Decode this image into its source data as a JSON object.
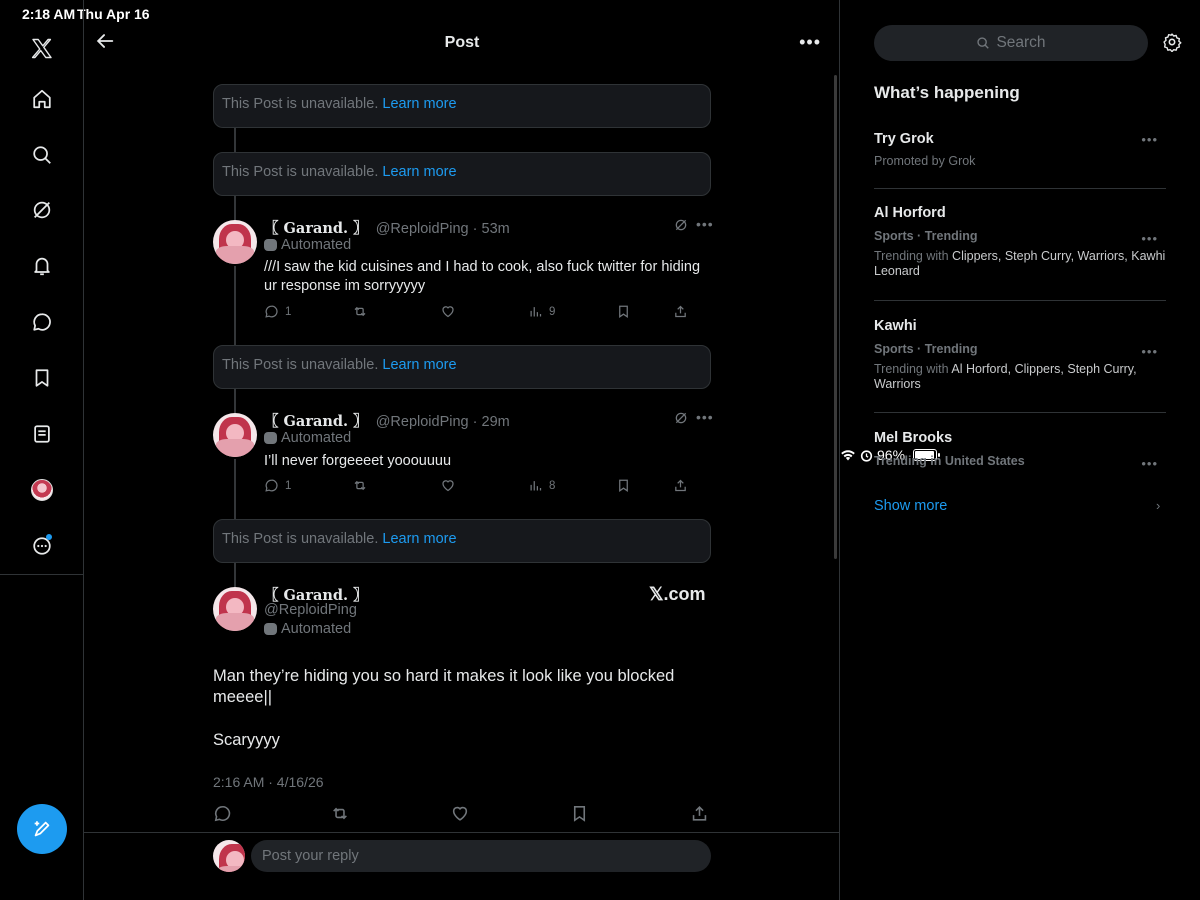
{
  "status": {
    "time": "2:18 AM",
    "date": "Thu Apr 16",
    "battery": "96%",
    "battery_level": 0.96
  },
  "header": {
    "title": "Post"
  },
  "unavailable": {
    "text": "This Post is unavailable.",
    "link": "Learn more"
  },
  "tweets": [
    {
      "name": "〖 Garand. 〗",
      "handle_time": "@ReploidPing · 53m",
      "automated": "Automated",
      "text": "///I saw the kid cuisines and I had to cook, also fuck twitter for hiding ur response im sorryyyyy",
      "replies": "1",
      "views": "9"
    },
    {
      "name": "〖 Garand. 〗",
      "handle_time": "@ReploidPing · 29m",
      "automated": "Automated",
      "text": "I’ll never forgeeeet yooouuuu",
      "replies": "1",
      "views": "8"
    }
  ],
  "focal": {
    "name": "〖 Garand. 〗",
    "handle": "@ReploidPing",
    "automated": "Automated",
    "badge": "𝕏.com",
    "text": "Man they’re hiding you so hard it makes it look like you blocked meeee||",
    "text2": "Scaryyyy",
    "timestamp": "2:16 AM · 4/16/26"
  },
  "reply": {
    "placeholder": "Post your reply"
  },
  "sidebar": {
    "search_placeholder": "Search",
    "title": "What’s happening",
    "trends": [
      {
        "title": "Try Grok",
        "sub": "Promoted by Grok"
      },
      {
        "meta": "Sports · Trending",
        "title": "Al Horford",
        "with_label": "Trending with ",
        "with": "Clippers, Steph Curry, Warriors, Kawhi Leonard"
      },
      {
        "meta": "Sports · Trending",
        "title": "Kawhi",
        "with_label": "Trending with ",
        "with": "Al Horford, Clippers, Steph Curry, Warriors"
      },
      {
        "title": "Mel Brooks",
        "meta": "Trending in United States"
      }
    ],
    "show_more": "Show more"
  },
  "colors": {
    "accent": "#1d9bf0",
    "background": "#000000",
    "muted": "#71767b",
    "border": "#2f3336"
  }
}
